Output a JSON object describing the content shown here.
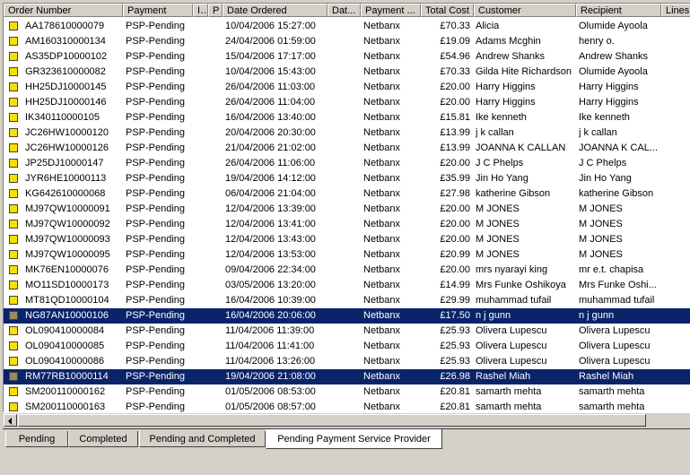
{
  "columns": [
    {
      "key": "order",
      "label": "Order Number"
    },
    {
      "key": "payment",
      "label": "Payment"
    },
    {
      "key": "i",
      "label": "I..."
    },
    {
      "key": "p",
      "label": "P"
    },
    {
      "key": "date",
      "label": "Date Ordered"
    },
    {
      "key": "dat2",
      "label": "Dat..."
    },
    {
      "key": "pay2",
      "label": "Payment ..."
    },
    {
      "key": "total",
      "label": "Total Cost"
    },
    {
      "key": "customer",
      "label": "Customer"
    },
    {
      "key": "recipient",
      "label": "Recipient"
    },
    {
      "key": "lines",
      "label": "Lines O"
    }
  ],
  "rows": [
    {
      "order": "AA178610000079",
      "payment": "PSP-Pending",
      "date": "10/04/2006 15:27:00",
      "pay2": "Netbanx",
      "total": "£70.33",
      "customer": "Alicia",
      "recipient": "Olumide Ayoola",
      "selected": false
    },
    {
      "order": "AM160310000134",
      "payment": "PSP-Pending",
      "date": "24/04/2006 01:59:00",
      "pay2": "Netbanx",
      "total": "£19.09",
      "customer": "Adams Mcghin",
      "recipient": "henry o.",
      "selected": false
    },
    {
      "order": "AS35DP10000102",
      "payment": "PSP-Pending",
      "date": "15/04/2006 17:17:00",
      "pay2": "Netbanx",
      "total": "£54.96",
      "customer": "Andrew Shanks",
      "recipient": "Andrew Shanks",
      "selected": false
    },
    {
      "order": "GR323610000082",
      "payment": "PSP-Pending",
      "date": "10/04/2006 15:43:00",
      "pay2": "Netbanx",
      "total": "£70.33",
      "customer": "Gilda Hite Richardson",
      "recipient": "Olumide Ayoola",
      "selected": false
    },
    {
      "order": "HH25DJ10000145",
      "payment": "PSP-Pending",
      "date": "26/04/2006 11:03:00",
      "pay2": "Netbanx",
      "total": "£20.00",
      "customer": "Harry Higgins",
      "recipient": "Harry Higgins",
      "selected": false
    },
    {
      "order": "HH25DJ10000146",
      "payment": "PSP-Pending",
      "date": "26/04/2006 11:04:00",
      "pay2": "Netbanx",
      "total": "£20.00",
      "customer": "Harry Higgins",
      "recipient": "Harry Higgins",
      "selected": false
    },
    {
      "order": "IK340110000105",
      "payment": "PSP-Pending",
      "date": "16/04/2006 13:40:00",
      "pay2": "Netbanx",
      "total": "£15.81",
      "customer": "Ike kenneth",
      "recipient": "Ike kenneth",
      "selected": false
    },
    {
      "order": "JC26HW10000120",
      "payment": "PSP-Pending",
      "date": "20/04/2006 20:30:00",
      "pay2": "Netbanx",
      "total": "£13.99",
      "customer": "j k callan",
      "recipient": "j k callan",
      "selected": false
    },
    {
      "order": "JC26HW10000126",
      "payment": "PSP-Pending",
      "date": "21/04/2006 21:02:00",
      "pay2": "Netbanx",
      "total": "£13.99",
      "customer": "JOANNA K CALLAN",
      "recipient": "JOANNA K CAL...",
      "selected": false
    },
    {
      "order": "JP25DJ10000147",
      "payment": "PSP-Pending",
      "date": "26/04/2006 11:06:00",
      "pay2": "Netbanx",
      "total": "£20.00",
      "customer": "J C Phelps",
      "recipient": "J C Phelps",
      "selected": false
    },
    {
      "order": "JYR6HE10000113",
      "payment": "PSP-Pending",
      "date": "19/04/2006 14:12:00",
      "pay2": "Netbanx",
      "total": "£35.99",
      "customer": "Jin Ho Yang",
      "recipient": "Jin Ho Yang",
      "selected": false
    },
    {
      "order": "KG642610000068",
      "payment": "PSP-Pending",
      "date": "06/04/2006 21:04:00",
      "pay2": "Netbanx",
      "total": "£27.98",
      "customer": "katherine Gibson",
      "recipient": "katherine Gibson",
      "selected": false
    },
    {
      "order": "MJ97QW10000091",
      "payment": "PSP-Pending",
      "date": "12/04/2006 13:39:00",
      "pay2": "Netbanx",
      "total": "£20.00",
      "customer": "M JONES",
      "recipient": "M JONES",
      "selected": false
    },
    {
      "order": "MJ97QW10000092",
      "payment": "PSP-Pending",
      "date": "12/04/2006 13:41:00",
      "pay2": "Netbanx",
      "total": "£20.00",
      "customer": "M JONES",
      "recipient": "M JONES",
      "selected": false
    },
    {
      "order": "MJ97QW10000093",
      "payment": "PSP-Pending",
      "date": "12/04/2006 13:43:00",
      "pay2": "Netbanx",
      "total": "£20.00",
      "customer": "M JONES",
      "recipient": "M JONES",
      "selected": false
    },
    {
      "order": "MJ97QW10000095",
      "payment": "PSP-Pending",
      "date": "12/04/2006 13:53:00",
      "pay2": "Netbanx",
      "total": "£20.99",
      "customer": "M JONES",
      "recipient": "M JONES",
      "selected": false
    },
    {
      "order": "MK76EN10000076",
      "payment": "PSP-Pending",
      "date": "09/04/2006 22:34:00",
      "pay2": "Netbanx",
      "total": "£20.00",
      "customer": "mrs nyarayi king",
      "recipient": "mr e.t. chapisa",
      "selected": false
    },
    {
      "order": "MO11SD10000173",
      "payment": "PSP-Pending",
      "date": "03/05/2006 13:20:00",
      "pay2": "Netbanx",
      "total": "£14.99",
      "customer": "Mrs Funke Oshikoya",
      "recipient": "Mrs Funke Oshi...",
      "selected": false
    },
    {
      "order": "MT81QD10000104",
      "payment": "PSP-Pending",
      "date": "16/04/2006 10:39:00",
      "pay2": "Netbanx",
      "total": "£29.99",
      "customer": "muhammad tufail",
      "recipient": "muhammad tufail",
      "selected": false
    },
    {
      "order": "NG87AN10000106",
      "payment": "PSP-Pending",
      "date": "16/04/2006 20:06:00",
      "pay2": "Netbanx",
      "total": "£17.50",
      "customer": "n j gunn",
      "recipient": "n j gunn",
      "selected": true
    },
    {
      "order": "OL090410000084",
      "payment": "PSP-Pending",
      "date": "11/04/2006 11:39:00",
      "pay2": "Netbanx",
      "total": "£25.93",
      "customer": "Olivera Lupescu",
      "recipient": "Olivera Lupescu",
      "selected": false
    },
    {
      "order": "OL090410000085",
      "payment": "PSP-Pending",
      "date": "11/04/2006 11:41:00",
      "pay2": "Netbanx",
      "total": "£25.93",
      "customer": "Olivera Lupescu",
      "recipient": "Olivera Lupescu",
      "selected": false
    },
    {
      "order": "OL090410000086",
      "payment": "PSP-Pending",
      "date": "11/04/2006 13:26:00",
      "pay2": "Netbanx",
      "total": "£25.93",
      "customer": "Olivera Lupescu",
      "recipient": "Olivera Lupescu",
      "selected": false
    },
    {
      "order": "RM77RB10000114",
      "payment": "PSP-Pending",
      "date": "19/04/2006 21:08:00",
      "pay2": "Netbanx",
      "total": "£26.98",
      "customer": "Rashel Miah",
      "recipient": "Rashel Miah",
      "selected": true
    },
    {
      "order": "SM200110000162",
      "payment": "PSP-Pending",
      "date": "01/05/2006 08:53:00",
      "pay2": "Netbanx",
      "total": "£20.81",
      "customer": "samarth mehta",
      "recipient": "samarth mehta",
      "selected": false
    },
    {
      "order": "SM200110000163",
      "payment": "PSP-Pending",
      "date": "01/05/2006 08:57:00",
      "pay2": "Netbanx",
      "total": "£20.81",
      "customer": "samarth mehta",
      "recipient": "samarth mehta",
      "selected": false
    }
  ],
  "tabs": [
    {
      "label": "Pending",
      "active": false
    },
    {
      "label": "Completed",
      "active": false
    },
    {
      "label": "Pending and Completed",
      "active": false
    },
    {
      "label": "Pending Payment Service Provider",
      "active": true
    }
  ],
  "colors": {
    "icon_normal": "#f5e000",
    "icon_selected": "#9c8a5c",
    "selection": "#0a246a"
  }
}
